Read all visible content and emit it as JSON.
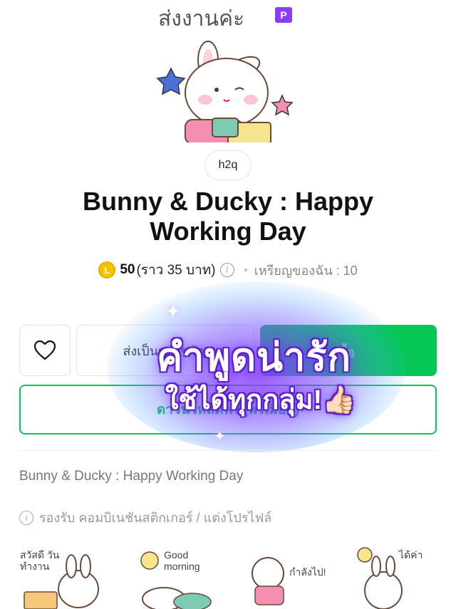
{
  "hero": {
    "sticker_text": "ส่งงานค่ะ",
    "badge": "P"
  },
  "author": "h2q",
  "title": "Bunny & Ducky : Happy Working Day",
  "price": {
    "coin_icon": "L",
    "amount": "50",
    "approx": "(ราว 35 บาท)",
    "info_icon": "i",
    "my_coins": "เหรียญของฉัน : 10"
  },
  "actions": {
    "gift_label": "ส่งเป็นของขวัญ",
    "buy_label": "ซื้อ",
    "download_label": "ดาวน์โหลดฟรี (พรีเมียม)"
  },
  "overlay": {
    "line1": "คำพูดน่ารัก",
    "line2": "ใช้ได้ทุกกลุ่ม!👍🏻"
  },
  "description": "Bunny & Ducky : Happy Working Day",
  "support": {
    "info_icon": "i",
    "text": "รองรับ คอมบิเนชันสติกเกอร์ / แต่งโปรไฟล์"
  },
  "thumbnails": [
    {
      "text": "สวัสดี วันทำงาน"
    },
    {
      "text": "Good morning"
    },
    {
      "text": "กำลังไป!"
    },
    {
      "text": "ได้ค่า"
    }
  ],
  "colors": {
    "green": "#06c755",
    "coin": "#f5c400",
    "overlay_purple": "#6a2bff",
    "badge": "#8b3cf7"
  }
}
